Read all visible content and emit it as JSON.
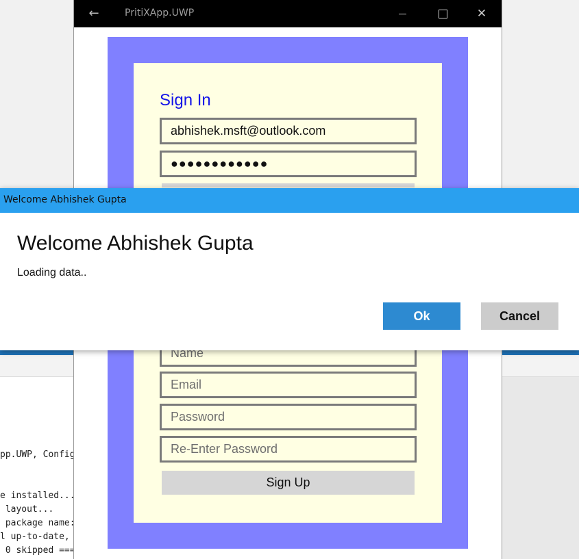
{
  "app": {
    "title": "PritiXApp.UWP",
    "back_glyph": "←",
    "close_glyph": "✕"
  },
  "signin": {
    "title": "Sign In",
    "email_value": "abhishek.msft@outlook.com",
    "password_value": "●●●●●●●●●●●●"
  },
  "signup": {
    "name_placeholder": "Name",
    "email_placeholder": "Email",
    "password_placeholder": "Password",
    "reenter_placeholder": "Re-Enter Password",
    "button_label": "Sign Up"
  },
  "dialog": {
    "window_title": "Welcome Abhishek Gupta",
    "heading": "Welcome Abhishek Gupta",
    "message": "Loading data..",
    "ok_label": "Ok",
    "cancel_label": "Cancel"
  },
  "console": {
    "lines": [
      "pp.UWP, Config",
      "e installed...",
      " layout...",
      " package name:",
      "l up-to-date,",
      " 0 skipped ==="
    ]
  },
  "colors": {
    "accent_blue": "#2aa0ef",
    "ok_button": "#2d8ad1",
    "frame_purple": "#8080ff",
    "panel_cream": "#ffffe3",
    "signin_title": "#1414e8"
  },
  "icons": {
    "back": "back-arrow-icon",
    "minimize": "minimize-icon",
    "maximize": "maximize-icon",
    "close": "close-icon"
  }
}
